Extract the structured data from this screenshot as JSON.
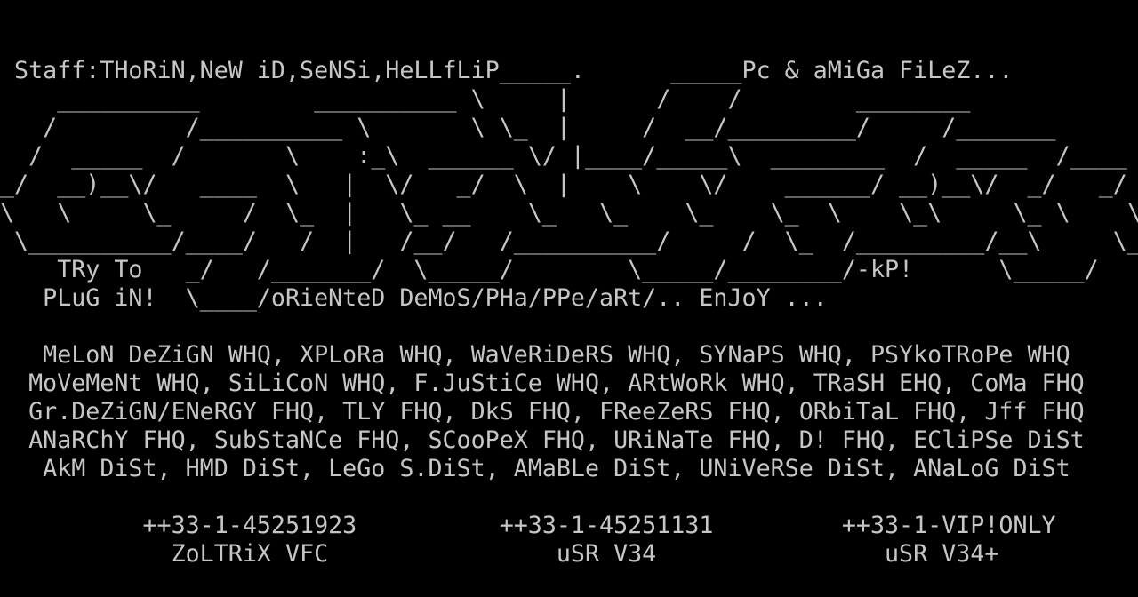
{
  "screen": {
    "background": "#000000",
    "foreground": "#c6c6c6",
    "lines": [
      " Staff:THoRiN,NeW iD,SeNSi,HeLLfLiP_____.      _____Pc & aMiGa FiLeZ...",
      "    __________        __________ \\     |      /    /        ________",
      "   /         /__________ \\       \\ \\_  |     /  __/_________/     /_______",
      "  /  _____  /       \\    :_\\  ______ \\/ |____/_____\\  ________  /  _____  /____  \\",
      "_/  __)__\\/   ____  \\   |  \\/   _/  \\  |    \\    \\/    ______/ __)__\\/  _/   _/",
      "\\   \\     \\_     /  \\_  |   \\_ __    \\_   \\_    \\_    \\_  \\    \\_\\     \\_ \\    \\",
      " \\__________/____/   /  |   /__/   /__________/     /  \\_  /_________/__\\     \\_",
      "    TRy To   _/   /_______/  \\_____/        \\_____/________/-kP!      \\_____/",
      "   PLuG iN!  \\____/oRieNteD DeMoS/PHa/PPe/aRt/.. EnJoY ...",
      "",
      "   MeLoN DeZiGN WHQ, XPLoRa WHQ, WaVeRiDeRS WHQ, SYNaPS WHQ, PSYkoTRoPe WHQ",
      "  MoVeMeNt WHQ, SiLiCoN WHQ, F.JuStiCe WHQ, ARtWoRk WHQ, TRaSH EHQ, CoMa FHQ",
      "  Gr.DeZiGN/ENeRGY FHQ, TLY FHQ, DkS FHQ, FReeZeRS FHQ, ORbiTaL FHQ, Jff FHQ",
      "  ANaRChY FHQ, SubStaNCe FHQ, SCooPeX FHQ, URiNaTe FHQ, D! FHQ, ECliPSe DiSt",
      "   AkM DiSt, HMD DiSt, LeGo S.DiSt, AMaBLe DiSt, UNiVeRSe DiSt, ANaLoG DiSt",
      "",
      "          ++33-1-45251923          ++33-1-45251131         ++33-1-VIP!ONLY",
      "            ZoLTRiX VFC                uSR V34                uSR V34+"
    ]
  }
}
